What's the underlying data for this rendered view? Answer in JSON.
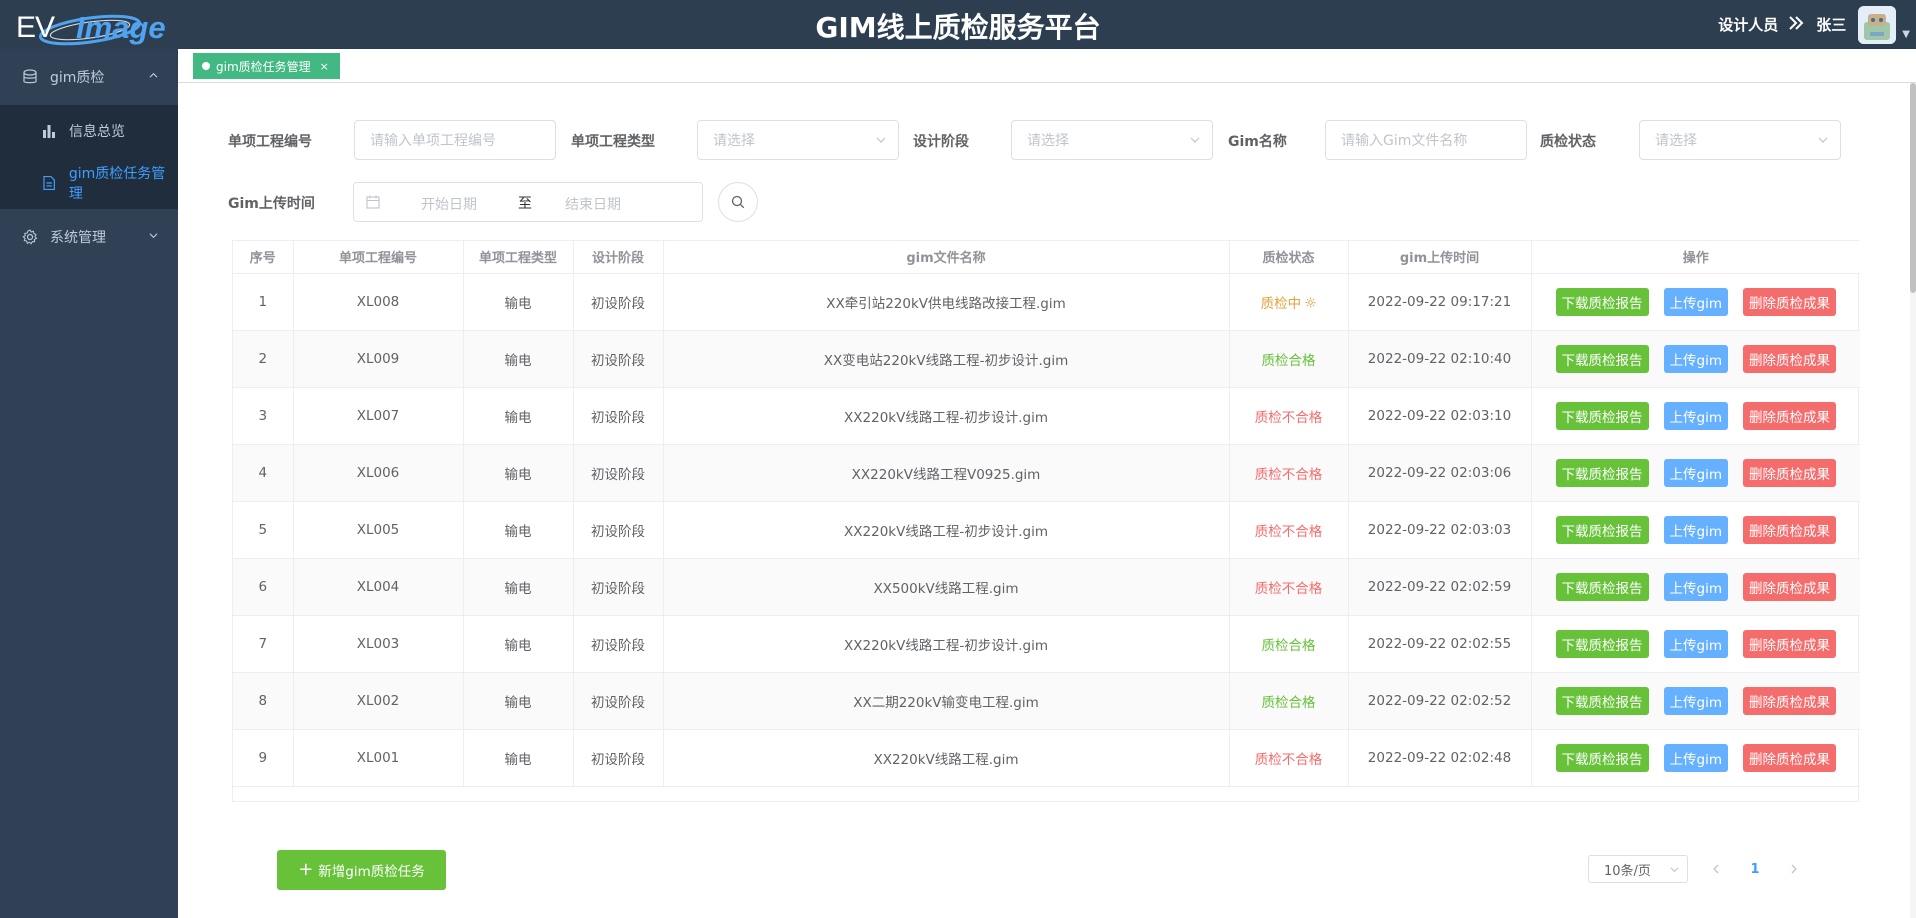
{
  "header": {
    "logo_ev": "EV",
    "logo_image": "Image",
    "title": "GIM线上质检服务平台",
    "role": "设计人员",
    "user_name": "张三"
  },
  "sidebar": {
    "groups": [
      {
        "label": "gim质检",
        "icon": "database-icon",
        "expanded": true
      },
      {
        "label": "系统管理",
        "icon": "gear-icon",
        "expanded": false
      }
    ],
    "items": [
      {
        "label": "信息总览",
        "icon": "bar-chart-icon",
        "active": false
      },
      {
        "label": "gim质检任务管理",
        "icon": "document-icon",
        "active": true
      }
    ]
  },
  "tabs": [
    {
      "label": "gim质检任务管理",
      "active": true
    }
  ],
  "filters": {
    "project_no_label": "单项工程编号",
    "project_no_placeholder": "请输入单项工程编号",
    "project_type_label": "单项工程类型",
    "project_type_placeholder": "请选择",
    "stage_label": "设计阶段",
    "stage_placeholder": "请选择",
    "gim_name_label": "Gim名称",
    "gim_name_placeholder": "请输入Gim文件名称",
    "status_label": "质检状态",
    "status_placeholder": "请选择",
    "upload_time_label": "Gim上传时间",
    "start_placeholder": "开始日期",
    "range_separator": "至",
    "end_placeholder": "结束日期"
  },
  "table": {
    "columns": [
      "序号",
      "单项工程编号",
      "单项工程类型",
      "设计阶段",
      "gim文件名称",
      "质检状态",
      "gim上传时间",
      "操作"
    ],
    "actions": {
      "download": "下载质检报告",
      "upload": "上传gim",
      "delete": "删除质检成果"
    },
    "rows": [
      {
        "no": "1",
        "code": "XL008",
        "type": "输电",
        "stage": "初设阶段",
        "file": "XX牵引站220kV供电线路改接工程.gim",
        "status": "质检中",
        "status_kind": "pending",
        "time": "2022-09-22 09:17:21"
      },
      {
        "no": "2",
        "code": "XL009",
        "type": "输电",
        "stage": "初设阶段",
        "file": "XX变电站220kV线路工程-初步设计.gim",
        "status": "质检合格",
        "status_kind": "pass",
        "time": "2022-09-22 02:10:40"
      },
      {
        "no": "3",
        "code": "XL007",
        "type": "输电",
        "stage": "初设阶段",
        "file": "XX220kV线路工程-初步设计.gim",
        "status": "质检不合格",
        "status_kind": "fail",
        "time": "2022-09-22 02:03:10"
      },
      {
        "no": "4",
        "code": "XL006",
        "type": "输电",
        "stage": "初设阶段",
        "file": "XX220kV线路工程V0925.gim",
        "status": "质检不合格",
        "status_kind": "fail",
        "time": "2022-09-22 02:03:06"
      },
      {
        "no": "5",
        "code": "XL005",
        "type": "输电",
        "stage": "初设阶段",
        "file": "XX220kV线路工程-初步设计.gim",
        "status": "质检不合格",
        "status_kind": "fail",
        "time": "2022-09-22 02:03:03"
      },
      {
        "no": "6",
        "code": "XL004",
        "type": "输电",
        "stage": "初设阶段",
        "file": "XX500kV线路工程.gim",
        "status": "质检不合格",
        "status_kind": "fail",
        "time": "2022-09-22 02:02:59"
      },
      {
        "no": "7",
        "code": "XL003",
        "type": "输电",
        "stage": "初设阶段",
        "file": "XX220kV线路工程-初步设计.gim",
        "status": "质检合格",
        "status_kind": "pass",
        "time": "2022-09-22 02:02:55"
      },
      {
        "no": "8",
        "code": "XL002",
        "type": "输电",
        "stage": "初设阶段",
        "file": "XX二期220kV输变电工程.gim",
        "status": "质检合格",
        "status_kind": "pass",
        "time": "2022-09-22 02:02:52"
      },
      {
        "no": "9",
        "code": "XL001",
        "type": "输电",
        "stage": "初设阶段",
        "file": "XX220kV线路工程.gim",
        "status": "质检不合格",
        "status_kind": "fail",
        "time": "2022-09-22 02:02:48"
      }
    ]
  },
  "footer": {
    "add_button": "新增gim质检任务",
    "page_size": "10条/页",
    "current_page": "1"
  },
  "colors": {
    "header_bg": "#2c3e50",
    "sidebar_bg": "#304156",
    "active_menu": "#409eff",
    "tag_bg": "#42b983",
    "status_pending": "#e6a23c",
    "status_pass": "#67c23a",
    "status_fail": "#f56c6c"
  }
}
